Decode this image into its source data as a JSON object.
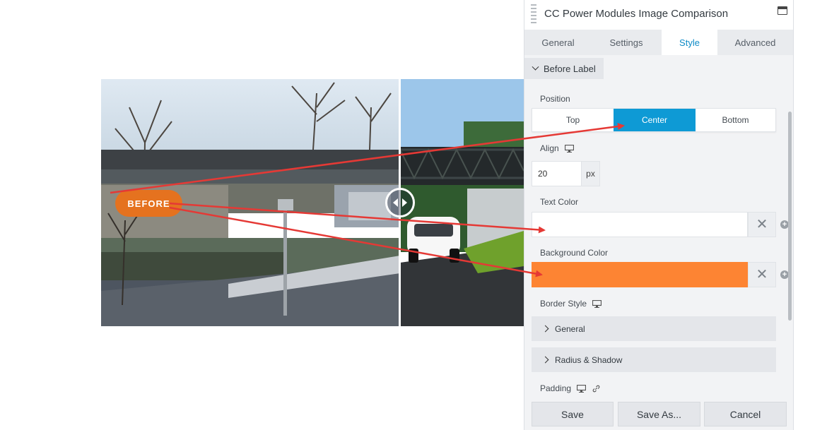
{
  "panel": {
    "title": "CC Power Modules Image Comparison",
    "tabs": [
      {
        "label": "General"
      },
      {
        "label": "Settings"
      },
      {
        "label": "Style"
      },
      {
        "label": "Advanced"
      }
    ],
    "active_tab": "Style",
    "section": {
      "label": "Before Label",
      "expanded": true
    },
    "position": {
      "label": "Position",
      "options": [
        "Top",
        "Center",
        "Bottom"
      ],
      "selected": "Center"
    },
    "align": {
      "label": "Align",
      "value": "20",
      "unit": "px"
    },
    "text_color": {
      "label": "Text Color",
      "value": "#ffffff"
    },
    "background_color": {
      "label": "Background Color",
      "value": "#fd8433"
    },
    "border_style": {
      "label": "Border Style",
      "groups": [
        {
          "label": "General"
        },
        {
          "label": "Radius & Shadow"
        }
      ]
    },
    "padding": {
      "label": "Padding"
    },
    "footer": {
      "save": "Save",
      "save_as": "Save As...",
      "cancel": "Cancel"
    },
    "accent_color": "#0e9ad5"
  },
  "comparison": {
    "before_label": "BEFORE",
    "before_label_color": "#e5721f",
    "handle_icon": "left-right-arrows-icon"
  },
  "annotations": {
    "arrow_color": "#e53935"
  }
}
